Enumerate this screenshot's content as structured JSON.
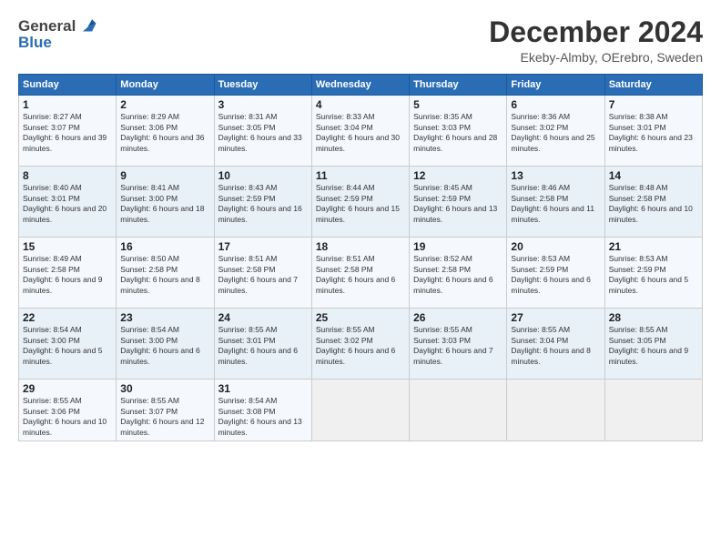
{
  "header": {
    "logo_line1": "General",
    "logo_line2": "Blue",
    "month_title": "December 2024",
    "location": "Ekeby-Almby, OErebro, Sweden"
  },
  "weekdays": [
    "Sunday",
    "Monday",
    "Tuesday",
    "Wednesday",
    "Thursday",
    "Friday",
    "Saturday"
  ],
  "weeks": [
    [
      {
        "day": 1,
        "sunrise": "8:27 AM",
        "sunset": "3:07 PM",
        "daylight": "6 hours and 39 minutes."
      },
      {
        "day": 2,
        "sunrise": "8:29 AM",
        "sunset": "3:06 PM",
        "daylight": "6 hours and 36 minutes."
      },
      {
        "day": 3,
        "sunrise": "8:31 AM",
        "sunset": "3:05 PM",
        "daylight": "6 hours and 33 minutes."
      },
      {
        "day": 4,
        "sunrise": "8:33 AM",
        "sunset": "3:04 PM",
        "daylight": "6 hours and 30 minutes."
      },
      {
        "day": 5,
        "sunrise": "8:35 AM",
        "sunset": "3:03 PM",
        "daylight": "6 hours and 28 minutes."
      },
      {
        "day": 6,
        "sunrise": "8:36 AM",
        "sunset": "3:02 PM",
        "daylight": "6 hours and 25 minutes."
      },
      {
        "day": 7,
        "sunrise": "8:38 AM",
        "sunset": "3:01 PM",
        "daylight": "6 hours and 23 minutes."
      }
    ],
    [
      {
        "day": 8,
        "sunrise": "8:40 AM",
        "sunset": "3:01 PM",
        "daylight": "6 hours and 20 minutes."
      },
      {
        "day": 9,
        "sunrise": "8:41 AM",
        "sunset": "3:00 PM",
        "daylight": "6 hours and 18 minutes."
      },
      {
        "day": 10,
        "sunrise": "8:43 AM",
        "sunset": "2:59 PM",
        "daylight": "6 hours and 16 minutes."
      },
      {
        "day": 11,
        "sunrise": "8:44 AM",
        "sunset": "2:59 PM",
        "daylight": "6 hours and 15 minutes."
      },
      {
        "day": 12,
        "sunrise": "8:45 AM",
        "sunset": "2:59 PM",
        "daylight": "6 hours and 13 minutes."
      },
      {
        "day": 13,
        "sunrise": "8:46 AM",
        "sunset": "2:58 PM",
        "daylight": "6 hours and 11 minutes."
      },
      {
        "day": 14,
        "sunrise": "8:48 AM",
        "sunset": "2:58 PM",
        "daylight": "6 hours and 10 minutes."
      }
    ],
    [
      {
        "day": 15,
        "sunrise": "8:49 AM",
        "sunset": "2:58 PM",
        "daylight": "6 hours and 9 minutes."
      },
      {
        "day": 16,
        "sunrise": "8:50 AM",
        "sunset": "2:58 PM",
        "daylight": "6 hours and 8 minutes."
      },
      {
        "day": 17,
        "sunrise": "8:51 AM",
        "sunset": "2:58 PM",
        "daylight": "6 hours and 7 minutes."
      },
      {
        "day": 18,
        "sunrise": "8:51 AM",
        "sunset": "2:58 PM",
        "daylight": "6 hours and 6 minutes."
      },
      {
        "day": 19,
        "sunrise": "8:52 AM",
        "sunset": "2:58 PM",
        "daylight": "6 hours and 6 minutes."
      },
      {
        "day": 20,
        "sunrise": "8:53 AM",
        "sunset": "2:59 PM",
        "daylight": "6 hours and 6 minutes."
      },
      {
        "day": 21,
        "sunrise": "8:53 AM",
        "sunset": "2:59 PM",
        "daylight": "6 hours and 5 minutes."
      }
    ],
    [
      {
        "day": 22,
        "sunrise": "8:54 AM",
        "sunset": "3:00 PM",
        "daylight": "6 hours and 5 minutes."
      },
      {
        "day": 23,
        "sunrise": "8:54 AM",
        "sunset": "3:00 PM",
        "daylight": "6 hours and 6 minutes."
      },
      {
        "day": 24,
        "sunrise": "8:55 AM",
        "sunset": "3:01 PM",
        "daylight": "6 hours and 6 minutes."
      },
      {
        "day": 25,
        "sunrise": "8:55 AM",
        "sunset": "3:02 PM",
        "daylight": "6 hours and 6 minutes."
      },
      {
        "day": 26,
        "sunrise": "8:55 AM",
        "sunset": "3:03 PM",
        "daylight": "6 hours and 7 minutes."
      },
      {
        "day": 27,
        "sunrise": "8:55 AM",
        "sunset": "3:04 PM",
        "daylight": "6 hours and 8 minutes."
      },
      {
        "day": 28,
        "sunrise": "8:55 AM",
        "sunset": "3:05 PM",
        "daylight": "6 hours and 9 minutes."
      }
    ],
    [
      {
        "day": 29,
        "sunrise": "8:55 AM",
        "sunset": "3:06 PM",
        "daylight": "6 hours and 10 minutes."
      },
      {
        "day": 30,
        "sunrise": "8:55 AM",
        "sunset": "3:07 PM",
        "daylight": "6 hours and 12 minutes."
      },
      {
        "day": 31,
        "sunrise": "8:54 AM",
        "sunset": "3:08 PM",
        "daylight": "6 hours and 13 minutes."
      },
      null,
      null,
      null,
      null
    ]
  ]
}
